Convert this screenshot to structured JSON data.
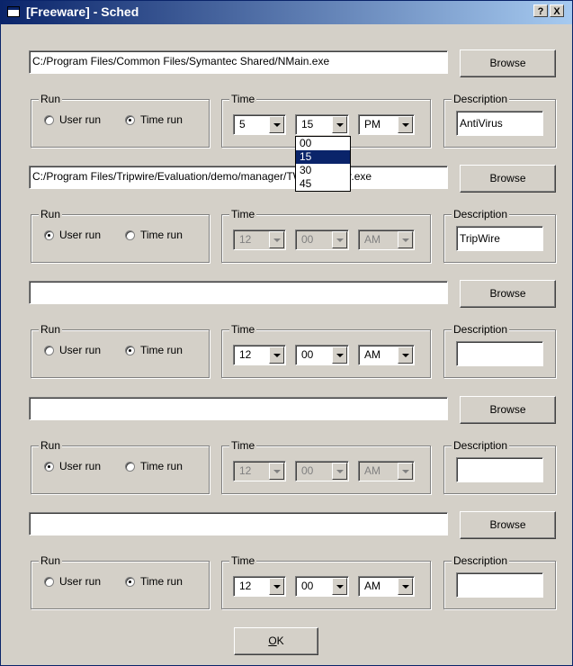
{
  "window": {
    "title": "[Freeware] - Sched",
    "help_btn": "?",
    "close_btn": "X"
  },
  "labels": {
    "run": "Run",
    "time": "Time",
    "description": "Description",
    "user_run": "User run",
    "time_run": "Time run",
    "browse": "Browse"
  },
  "rows": [
    {
      "path": "C:/Program Files/Common Files/Symantec Shared/NMain.exe",
      "run_mode": "time",
      "hour": "5",
      "minute": "15",
      "ampm": "PM",
      "time_enabled": true,
      "description": "AntiVirus"
    },
    {
      "path": "C:/Program Files/Tripwire/Evaluation/demo/manager/TW_Manager.exe",
      "run_mode": "user",
      "hour": "12",
      "minute": "00",
      "ampm": "AM",
      "time_enabled": false,
      "description": "TripWire"
    },
    {
      "path": "",
      "run_mode": "time",
      "hour": "12",
      "minute": "00",
      "ampm": "AM",
      "time_enabled": true,
      "description": ""
    },
    {
      "path": "",
      "run_mode": "user",
      "hour": "12",
      "minute": "00",
      "ampm": "AM",
      "time_enabled": false,
      "description": ""
    },
    {
      "path": "",
      "run_mode": "time",
      "hour": "12",
      "minute": "00",
      "ampm": "AM",
      "time_enabled": true,
      "description": ""
    }
  ],
  "dropdown": {
    "options": [
      "00",
      "15",
      "30",
      "45"
    ],
    "selected": "15"
  },
  "ok_button": {
    "label": "OK",
    "mnemonic": "O"
  }
}
